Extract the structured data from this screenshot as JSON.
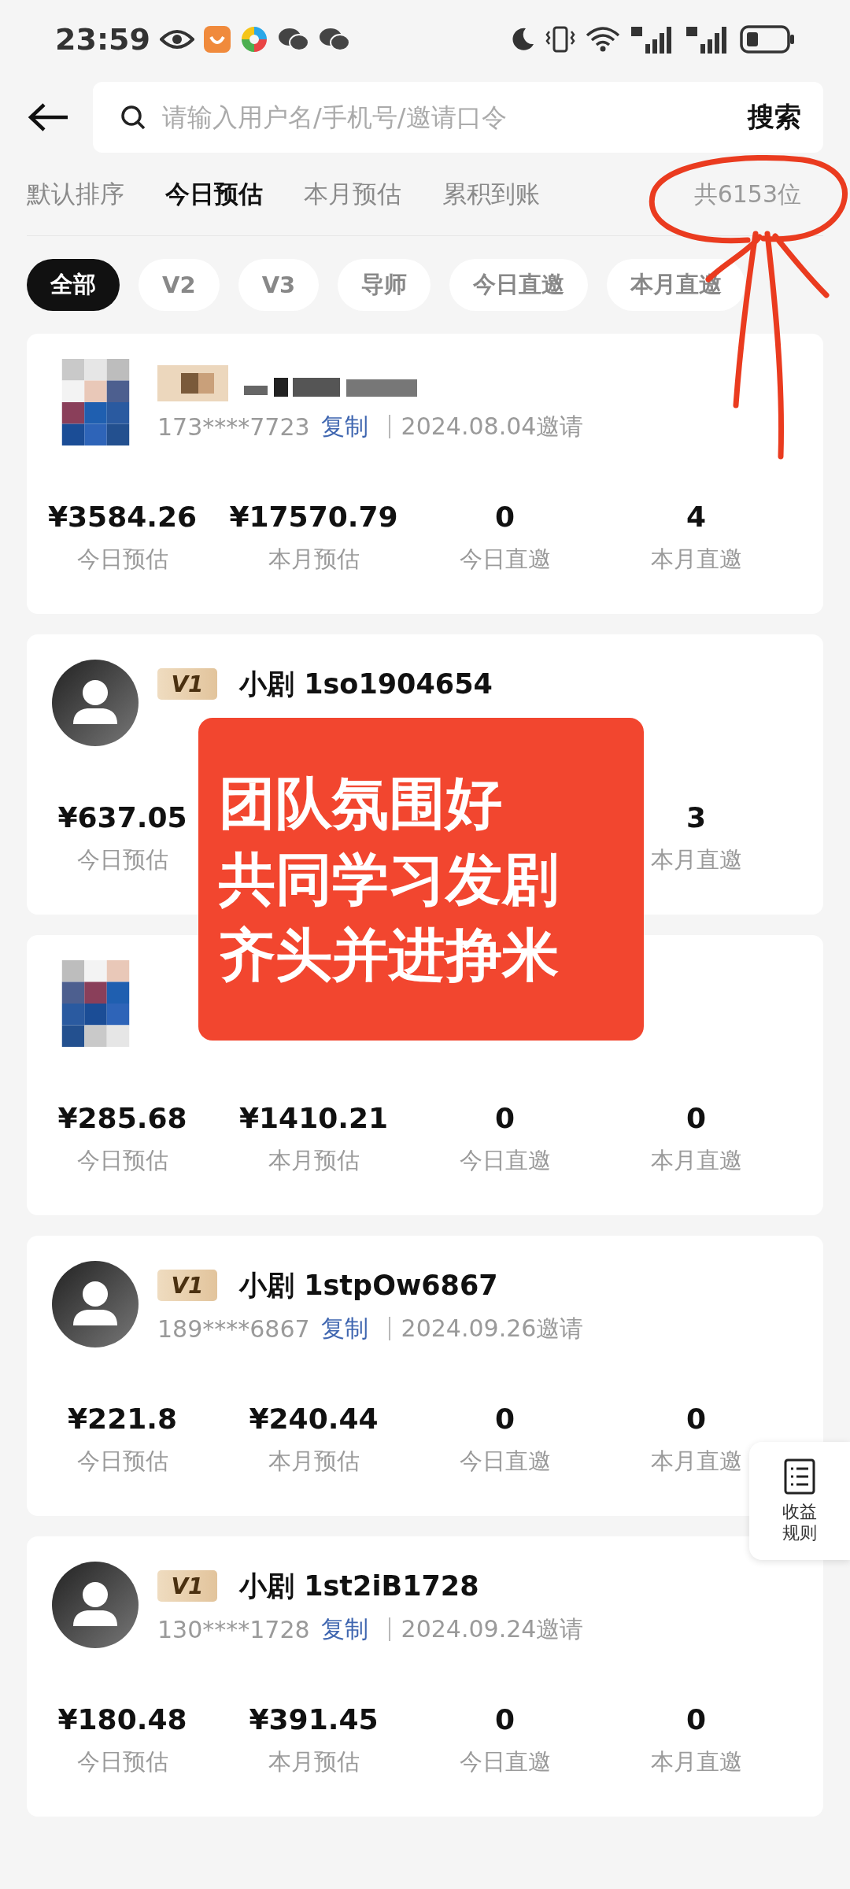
{
  "status_bar": {
    "time": "23:59"
  },
  "search": {
    "placeholder": "请输入用户名/手机号/邀请口令",
    "button": "搜索"
  },
  "sort_tabs": [
    {
      "label": "默认排序",
      "selected": false
    },
    {
      "label": "今日预估",
      "selected": true
    },
    {
      "label": "本月预估",
      "selected": false
    },
    {
      "label": "累积到账",
      "selected": false
    }
  ],
  "total": "共6153位",
  "chips": [
    {
      "label": "全部",
      "selected": true
    },
    {
      "label": "V2",
      "selected": false
    },
    {
      "label": "V3",
      "selected": false
    },
    {
      "label": "导师",
      "selected": false
    },
    {
      "label": "今日直邀",
      "selected": false
    },
    {
      "label": "本月直邀",
      "selected": false
    }
  ],
  "cards": [
    {
      "kind": "mosaic",
      "name_redacted": true,
      "phone": "173****7723",
      "copy": "复制",
      "invited": "2024.08.04邀请",
      "stats": [
        {
          "value": "¥3584.26",
          "label": "今日预估"
        },
        {
          "value": "¥17570.79",
          "label": "本月预估"
        },
        {
          "value": "0",
          "label": "今日直邀"
        },
        {
          "value": "4",
          "label": "本月直邀"
        }
      ]
    },
    {
      "kind": "person",
      "badge": "V1",
      "name": "小剧 1so1904654",
      "stats": [
        {
          "value": "¥637.05",
          "label": "今日预估"
        },
        {
          "value": "3",
          "label": "本月直邀"
        }
      ]
    },
    {
      "kind": "mosaic",
      "stats": [
        {
          "value": "¥285.68",
          "label": "今日预估"
        },
        {
          "value": "¥1410.21",
          "label": "本月预估"
        },
        {
          "value": "0",
          "label": "今日直邀"
        },
        {
          "value": "0",
          "label": "本月直邀"
        }
      ]
    },
    {
      "kind": "person",
      "badge": "V1",
      "name": "小剧 1stpOw6867",
      "phone": "189****6867",
      "copy": "复制",
      "invited": "2024.09.26邀请",
      "stats": [
        {
          "value": "¥221.8",
          "label": "今日预估"
        },
        {
          "value": "¥240.44",
          "label": "本月预估"
        },
        {
          "value": "0",
          "label": "今日直邀"
        },
        {
          "value": "0",
          "label": "本月直邀"
        }
      ]
    },
    {
      "kind": "person",
      "badge": "V1",
      "name": "小剧 1st2iB1728",
      "phone": "130****1728",
      "copy": "复制",
      "invited": "2024.09.24邀请",
      "stats": [
        {
          "value": "¥180.48",
          "label": "今日预估"
        },
        {
          "value": "¥391.45",
          "label": "本月预估"
        },
        {
          "value": "0",
          "label": "今日直邀"
        },
        {
          "value": "0",
          "label": "本月直邀"
        }
      ]
    }
  ],
  "banner": {
    "lines": [
      "团队氛围好",
      "共同学习发剧",
      "齐头并进挣米"
    ]
  },
  "float_button": {
    "label": "收益规则"
  }
}
